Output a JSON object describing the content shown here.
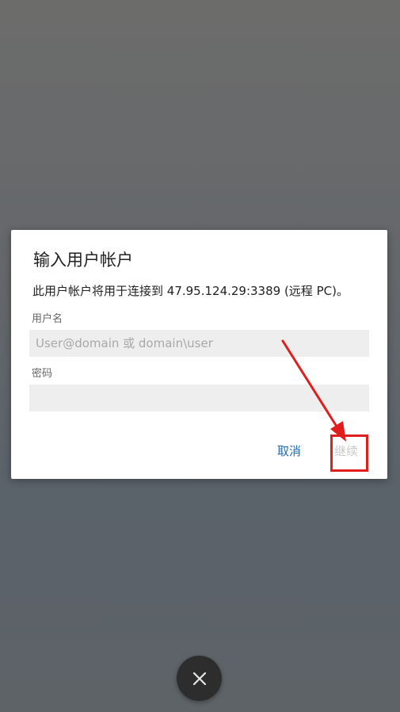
{
  "dialog": {
    "title": "输入用户帐户",
    "message": "此用户帐户将用于连接到 47.95.124.29:3389 (远程 PC)。",
    "username": {
      "label": "用户名",
      "placeholder": "User@domain 或 domain\\user",
      "value": ""
    },
    "password": {
      "label": "密码",
      "value": ""
    },
    "buttons": {
      "cancel": "取消",
      "continue": "继续"
    }
  },
  "fab": {
    "icon": "close-icon"
  },
  "colors": {
    "accent": "#1a6bb5",
    "disabled": "#c9c9c9",
    "annotation": "#e01e1e"
  }
}
